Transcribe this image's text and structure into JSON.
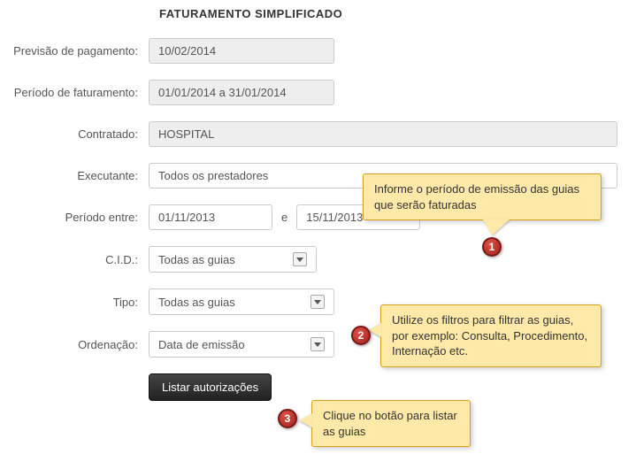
{
  "title": "FATURAMENTO SIMPLIFICADO",
  "fields": {
    "previsao_label": "Previsão de pagamento:",
    "previsao_value": "10/02/2014",
    "periodo_fat_label": "Período de faturamento:",
    "periodo_fat_value": "01/01/2014 a 31/01/2014",
    "contratado_label": "Contratado:",
    "contratado_value": "HOSPITAL",
    "executante_label": "Executante:",
    "executante_value": "Todos os prestadores",
    "periodo_entre_label": "Período entre:",
    "periodo_inicio": "01/11/2013",
    "periodo_sep": "e",
    "periodo_fim": "15/11/2013",
    "cid_label": "C.I.D.:",
    "cid_value": "Todas as guias",
    "tipo_label": "Tipo:",
    "tipo_value": "Todas as guias",
    "ordenacao_label": "Ordenação:",
    "ordenacao_value": "Data de emissão",
    "btn_listar": "Listar autorizações"
  },
  "callouts": {
    "c1": "Informe o período de emissão das guias que serão faturadas",
    "c2": "Utilize os filtros para filtrar as guias, por exemplo: Consulta, Procedimento, Internação etc.",
    "c3": "Clique no botão para listar as guias"
  },
  "markers": {
    "m1": "1",
    "m2": "2",
    "m3": "3"
  }
}
